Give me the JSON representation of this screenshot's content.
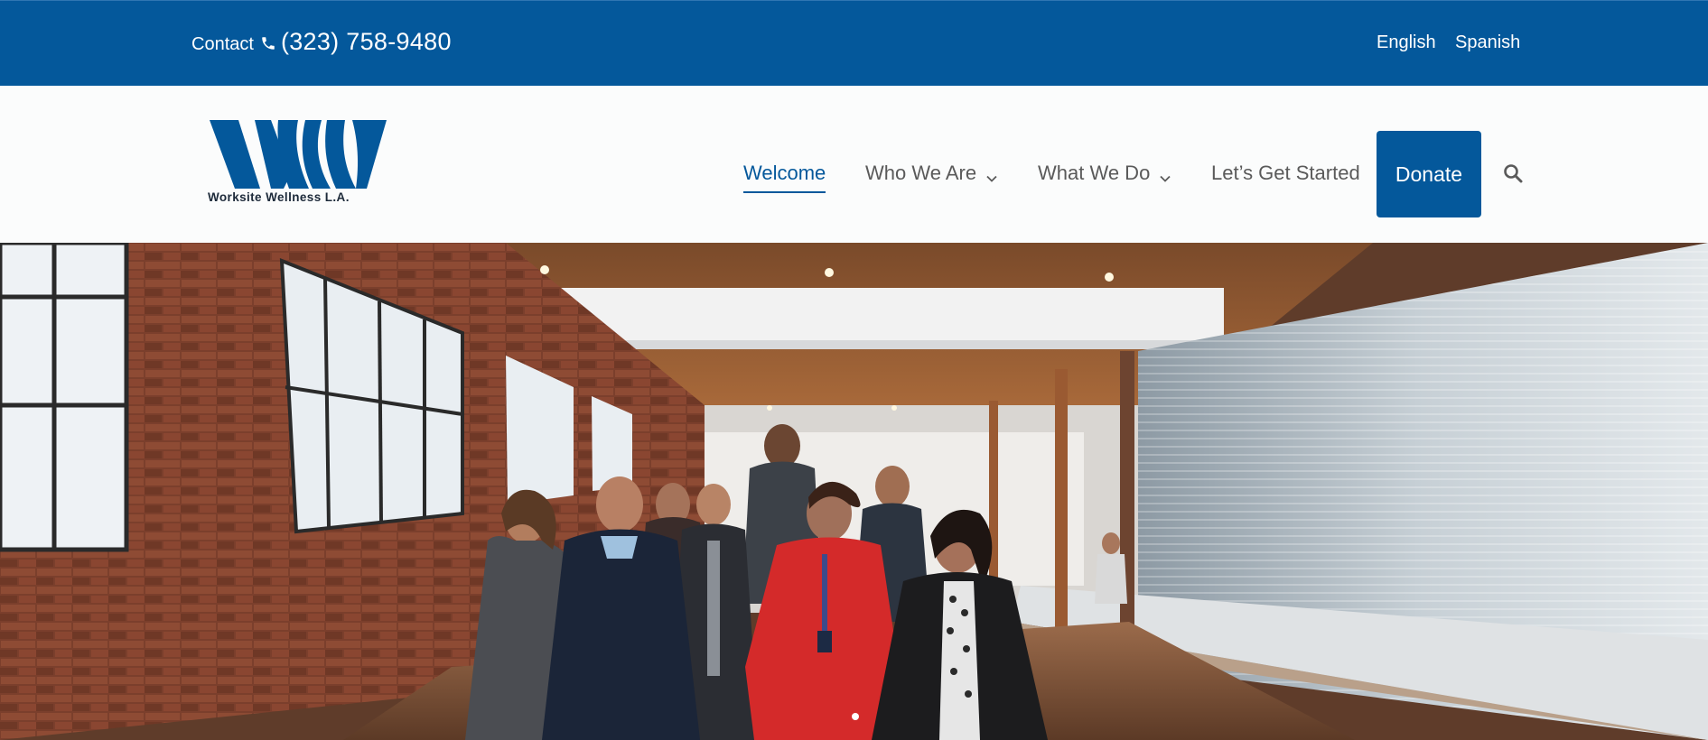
{
  "topbar": {
    "contact_label": "Contact",
    "phone_icon": "phone-icon",
    "phone_number": "(323) 758-9480",
    "languages": [
      "English",
      "Spanish"
    ],
    "background_color": "#04589b"
  },
  "header": {
    "logo": {
      "mark": "WW",
      "text": "Worksite Wellness L.A."
    },
    "nav": {
      "items": [
        {
          "label": "Welcome",
          "active": true,
          "has_dropdown": false
        },
        {
          "label": "Who We Are",
          "active": false,
          "has_dropdown": true
        },
        {
          "label": "What We Do",
          "active": false,
          "has_dropdown": true
        },
        {
          "label": "Let’s Get Started",
          "active": false,
          "has_dropdown": false
        }
      ],
      "donate_label": "Donate",
      "search_icon": "search-icon"
    },
    "accent_color": "#04589b"
  },
  "hero": {
    "image": "group-of-people-walking-in-loft-office",
    "slider": {
      "total_slides": 1,
      "current_slide": 1
    }
  }
}
